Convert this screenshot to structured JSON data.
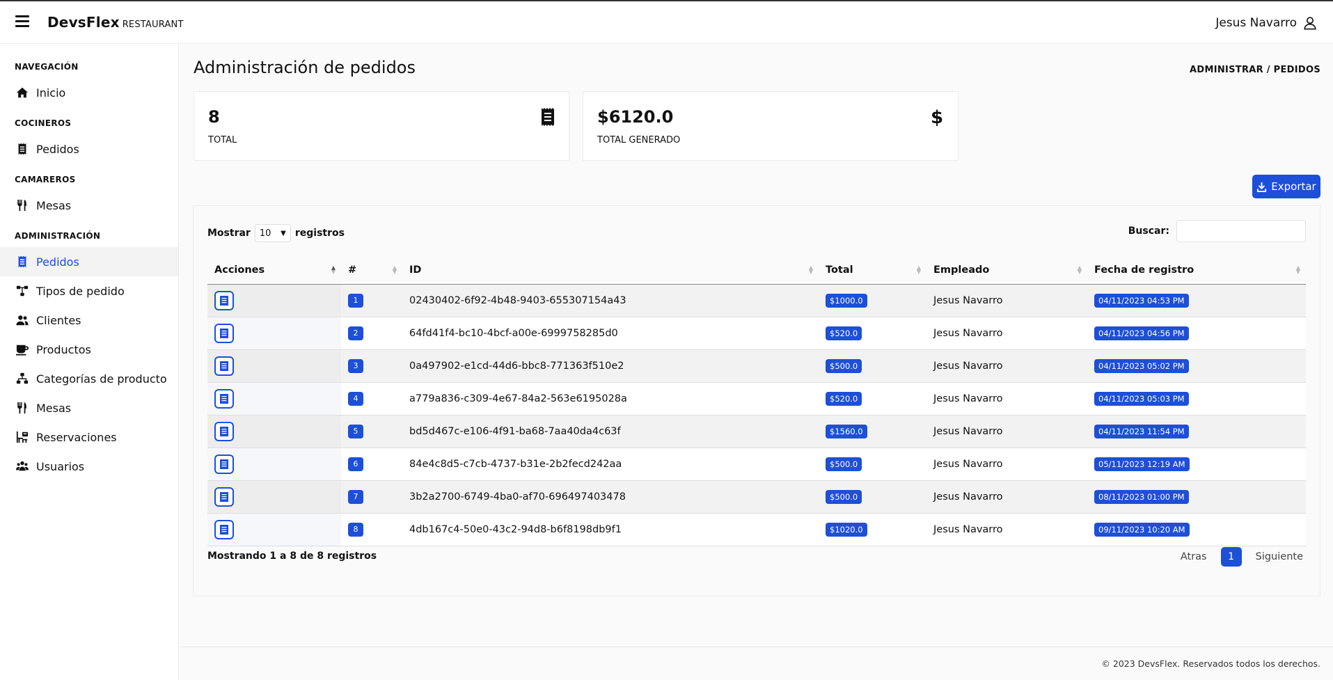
{
  "app": {
    "brand": "DevsFlex",
    "brand_sub": "RESTAURANT",
    "user_name": "Jesus Navarro"
  },
  "sidebar": {
    "sections": [
      {
        "title": "NAVEGACIÓN",
        "items": [
          {
            "label": "Inicio",
            "icon": "home-icon"
          }
        ]
      },
      {
        "title": "COCINEROS",
        "items": [
          {
            "label": "Pedidos",
            "icon": "receipt-icon"
          }
        ]
      },
      {
        "title": "CAMAREROS",
        "items": [
          {
            "label": "Mesas",
            "icon": "utensils-icon"
          }
        ]
      },
      {
        "title": "ADMINISTRACIÓN",
        "items": [
          {
            "label": "Pedidos",
            "icon": "receipt-icon",
            "active": true
          },
          {
            "label": "Tipos de pedido",
            "icon": "sitemap-icon"
          },
          {
            "label": "Clientes",
            "icon": "users-icon"
          },
          {
            "label": "Productos",
            "icon": "mug-icon"
          },
          {
            "label": "Categorías de producto",
            "icon": "hierarchy-icon"
          },
          {
            "label": "Mesas",
            "icon": "utensils-icon"
          },
          {
            "label": "Reservaciones",
            "icon": "reservation-icon"
          },
          {
            "label": "Usuarios",
            "icon": "user-group-icon"
          }
        ]
      }
    ]
  },
  "main": {
    "title": "Administración de pedidos",
    "breadcrumb": "ADMINISTRAR / PEDIDOS",
    "cards": [
      {
        "value": "8",
        "label": "TOTAL",
        "icon": "receipt-icon"
      },
      {
        "value": "$6120.0",
        "label": "TOTAL GENERADO",
        "icon": "dollar-icon"
      }
    ],
    "export_label": "Exportar"
  },
  "table": {
    "length_prefix": "Mostrar",
    "length_value": "10",
    "length_suffix": "registros",
    "search_label": "Buscar:",
    "search_value": "",
    "columns": [
      "Acciones",
      "#",
      "ID",
      "Total",
      "Empleado",
      "Fecha de registro"
    ],
    "rows": [
      {
        "n": "1",
        "id": "02430402-6f92-4b48-9403-655307154a43",
        "total": "$1000.0",
        "empleado": "Jesus Navarro",
        "fecha": "04/11/2023 04:53 PM"
      },
      {
        "n": "2",
        "id": "64fd41f4-bc10-4bcf-a00e-6999758285d0",
        "total": "$520.0",
        "empleado": "Jesus Navarro",
        "fecha": "04/11/2023 04:56 PM"
      },
      {
        "n": "3",
        "id": "0a497902-e1cd-44d6-bbc8-771363f510e2",
        "total": "$500.0",
        "empleado": "Jesus Navarro",
        "fecha": "04/11/2023 05:02 PM"
      },
      {
        "n": "4",
        "id": "a779a836-c309-4e67-84a2-563e6195028a",
        "total": "$520.0",
        "empleado": "Jesus Navarro",
        "fecha": "04/11/2023 05:03 PM"
      },
      {
        "n": "5",
        "id": "bd5d467c-e106-4f91-ba68-7aa40da4c63f",
        "total": "$1560.0",
        "empleado": "Jesus Navarro",
        "fecha": "04/11/2023 11:54 PM"
      },
      {
        "n": "6",
        "id": "84e4c8d5-c7cb-4737-b31e-2b2fecd242aa",
        "total": "$500.0",
        "empleado": "Jesus Navarro",
        "fecha": "05/11/2023 12:19 AM"
      },
      {
        "n": "7",
        "id": "3b2a2700-6749-4ba0-af70-696497403478",
        "total": "$500.0",
        "empleado": "Jesus Navarro",
        "fecha": "08/11/2023 01:00 PM"
      },
      {
        "n": "8",
        "id": "4db167c4-50e0-43c2-94d8-b6f8198db9f1",
        "total": "$1020.0",
        "empleado": "Jesus Navarro",
        "fecha": "09/11/2023 10:20 AM"
      }
    ],
    "info": "Mostrando 1 a 8 de 8 registros",
    "pager": {
      "prev": "Atras",
      "current": "1",
      "next": "Siguiente"
    }
  },
  "footer": {
    "text": "© 2023 DevsFlex. Reservados todos los derechos."
  },
  "colors": {
    "accent": "#1d4fd8"
  }
}
